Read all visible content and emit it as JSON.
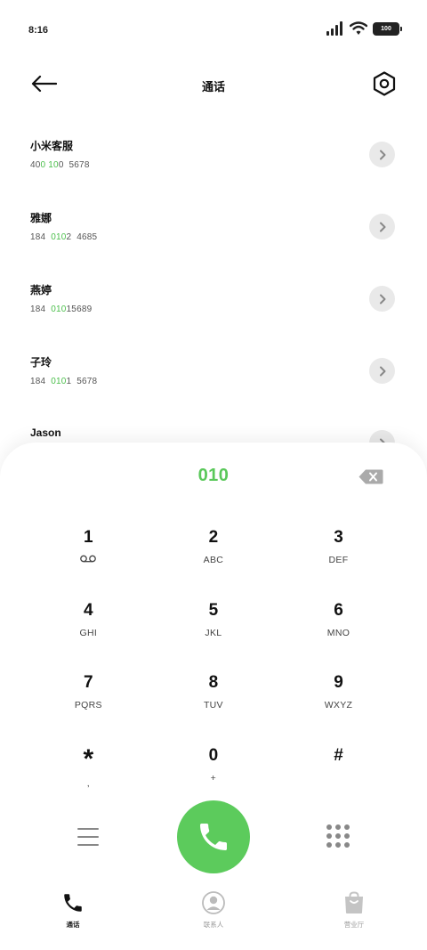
{
  "status_bar": {
    "time": "8:16",
    "battery": "100"
  },
  "header": {
    "title": "通话"
  },
  "contacts": [
    {
      "name": "小米客服",
      "number_parts": [
        {
          "t": "40",
          "h": false
        },
        {
          "t": "0",
          "h": true
        },
        {
          "t": " ",
          "h": false
        },
        {
          "t": "10",
          "h": true
        },
        {
          "t": "0  5678",
          "h": false
        }
      ]
    },
    {
      "name": "雅娜",
      "number_parts": [
        {
          "t": "184  ",
          "h": false
        },
        {
          "t": "010",
          "h": true
        },
        {
          "t": "2  4685",
          "h": false
        }
      ]
    },
    {
      "name": "燕婷",
      "number_parts": [
        {
          "t": "184  ",
          "h": false
        },
        {
          "t": "010",
          "h": true
        },
        {
          "t": "15689",
          "h": false
        }
      ]
    },
    {
      "name": "子玲",
      "number_parts": [
        {
          "t": "184  ",
          "h": false
        },
        {
          "t": "010",
          "h": true
        },
        {
          "t": "1  5678",
          "h": false
        }
      ]
    },
    {
      "name": "Jason",
      "number_parts": []
    }
  ],
  "dialer": {
    "dialed_number": "010",
    "keys": [
      {
        "digit": "1",
        "letters": "",
        "icon": "voicemail-icon"
      },
      {
        "digit": "2",
        "letters": "ABC"
      },
      {
        "digit": "3",
        "letters": "DEF"
      },
      {
        "digit": "4",
        "letters": "GHI"
      },
      {
        "digit": "5",
        "letters": "JKL"
      },
      {
        "digit": "6",
        "letters": "MNO"
      },
      {
        "digit": "7",
        "letters": "PQRS"
      },
      {
        "digit": "8",
        "letters": "TUV"
      },
      {
        "digit": "9",
        "letters": "WXYZ"
      },
      {
        "digit": "*",
        "letters": ","
      },
      {
        "digit": "0",
        "letters": "+"
      },
      {
        "digit": "#",
        "letters": ""
      }
    ]
  },
  "tabs": [
    {
      "label": "通话",
      "icon": "phone-icon",
      "active": true
    },
    {
      "label": "联系人",
      "icon": "contact-icon",
      "active": false
    },
    {
      "label": "营业厅",
      "icon": "shopping-bag-icon",
      "active": false
    }
  ],
  "colors": {
    "accent_green": "#5ccb5c",
    "highlight_green": "#4cbf4c"
  }
}
